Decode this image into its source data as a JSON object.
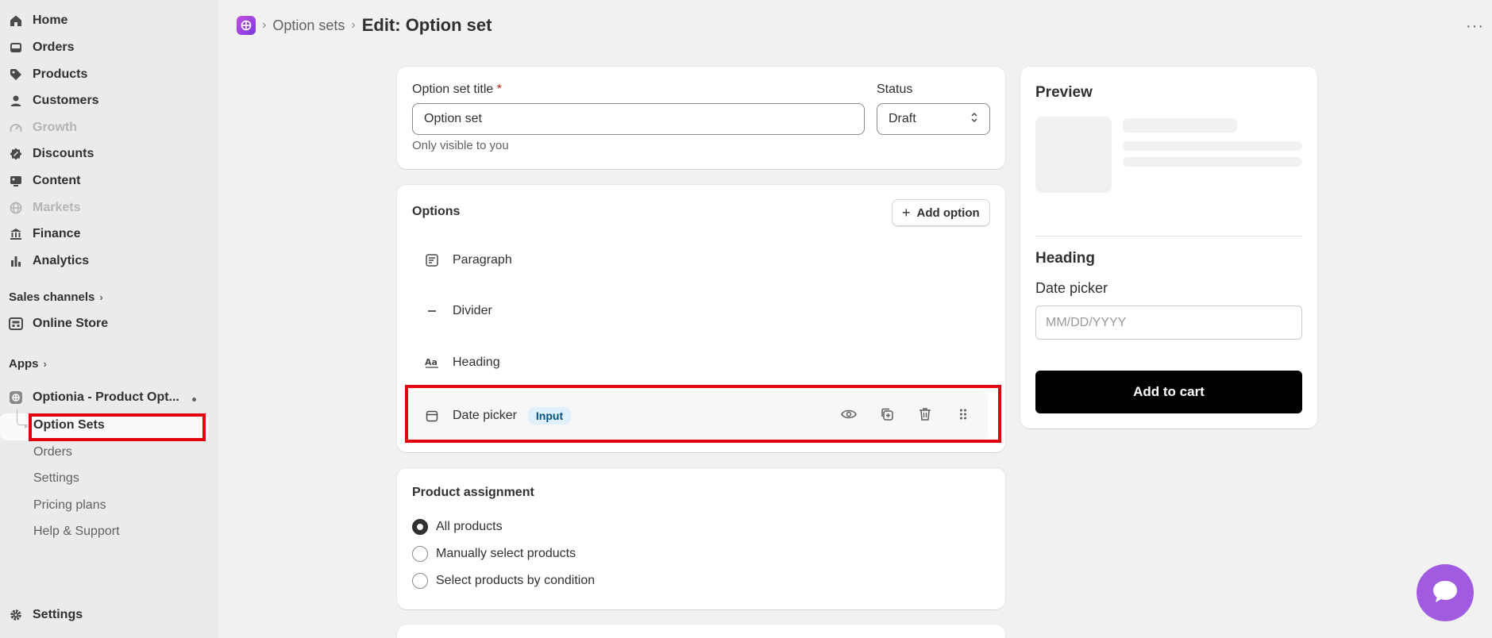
{
  "sidebar": {
    "main_items": [
      {
        "label": "Home",
        "icon": "home-icon"
      },
      {
        "label": "Orders",
        "icon": "inbox-icon"
      },
      {
        "label": "Products",
        "icon": "tag-icon"
      },
      {
        "label": "Customers",
        "icon": "person-icon"
      },
      {
        "label": "Growth",
        "icon": "gauge-icon"
      },
      {
        "label": "Discounts",
        "icon": "discount-icon"
      },
      {
        "label": "Content",
        "icon": "image-icon"
      },
      {
        "label": "Markets",
        "icon": "globe-icon"
      },
      {
        "label": "Finance",
        "icon": "bank-icon"
      },
      {
        "label": "Analytics",
        "icon": "bar-chart-icon"
      }
    ],
    "sales_channels_label": "Sales channels",
    "online_store_label": "Online Store",
    "apps_label": "Apps",
    "app_name": "Optionia - Product Opt...",
    "app_sub_items": [
      "Option Sets",
      "Orders",
      "Settings",
      "Pricing plans",
      "Help & Support"
    ],
    "settings_label": "Settings"
  },
  "header": {
    "breadcrumb": "Option sets",
    "title": "Edit: Option set"
  },
  "title_card": {
    "title_label": "Option set title",
    "required_mark": "*",
    "title_value": "Option set",
    "helper": "Only visible to you",
    "status_label": "Status",
    "status_value": "Draft"
  },
  "options_card": {
    "heading": "Options",
    "add_button": "Add option",
    "items": [
      {
        "label": "Paragraph",
        "icon": "paragraph-icon"
      },
      {
        "label": "Divider",
        "icon": "divider-icon"
      },
      {
        "label": "Heading",
        "icon": "heading-icon"
      },
      {
        "label": "Date picker",
        "icon": "calendar-icon",
        "badge": "Input"
      }
    ]
  },
  "assignment_card": {
    "heading": "Product assignment",
    "options": [
      "All products",
      "Manually select products",
      "Select products by condition"
    ],
    "selected": "All products"
  },
  "preview": {
    "title": "Preview",
    "heading": "Heading",
    "field_label": "Date picker",
    "field_placeholder": "MM/DD/YYYY",
    "button": "Add to cart"
  },
  "colors": {
    "highlight": "#e0000f",
    "chat": "#a15be0",
    "badge_bg": "#e0f0ff"
  }
}
